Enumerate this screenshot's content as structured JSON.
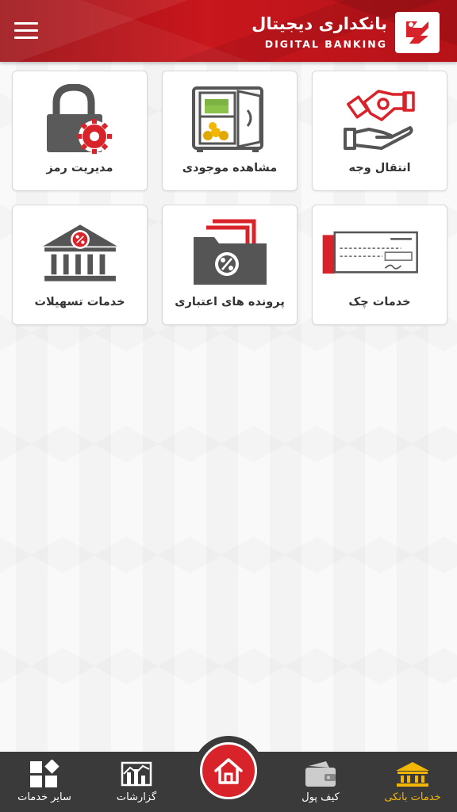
{
  "header": {
    "title_fa": "بانکداری دیجیتال",
    "title_en": "DIGITAL BANKING",
    "menu_icon": "hamburger-menu-icon",
    "logo_icon": "bank-logo-icon",
    "colors": {
      "primary": "#c8171d",
      "dark": "#9b0d12"
    }
  },
  "services": [
    {
      "label": "انتقال وجه",
      "icon": "money-transfer-icon"
    },
    {
      "label": "مشاهده موجودی",
      "icon": "safe-balance-icon"
    },
    {
      "label": "مدیریت رمز",
      "icon": "password-lock-icon"
    },
    {
      "label": "خدمات چک",
      "icon": "cheque-icon"
    },
    {
      "label": "پرونده های اعتباری",
      "icon": "credit-folder-icon"
    },
    {
      "label": "خدمات تسهیلات",
      "icon": "loan-bank-icon"
    }
  ],
  "bottom_nav": {
    "items": [
      {
        "label": "خدمات بانکی",
        "icon": "bank-services-icon",
        "active": true
      },
      {
        "label": "کیف پول",
        "icon": "wallet-icon",
        "active": false
      },
      {
        "label": "گزارشات",
        "icon": "reports-chart-icon",
        "active": false
      },
      {
        "label": "سایر خدمات",
        "icon": "other-services-icon",
        "active": false
      }
    ],
    "home_icon": "home-icon",
    "active_color": "#f2b705",
    "background": "#3a3a3a"
  }
}
